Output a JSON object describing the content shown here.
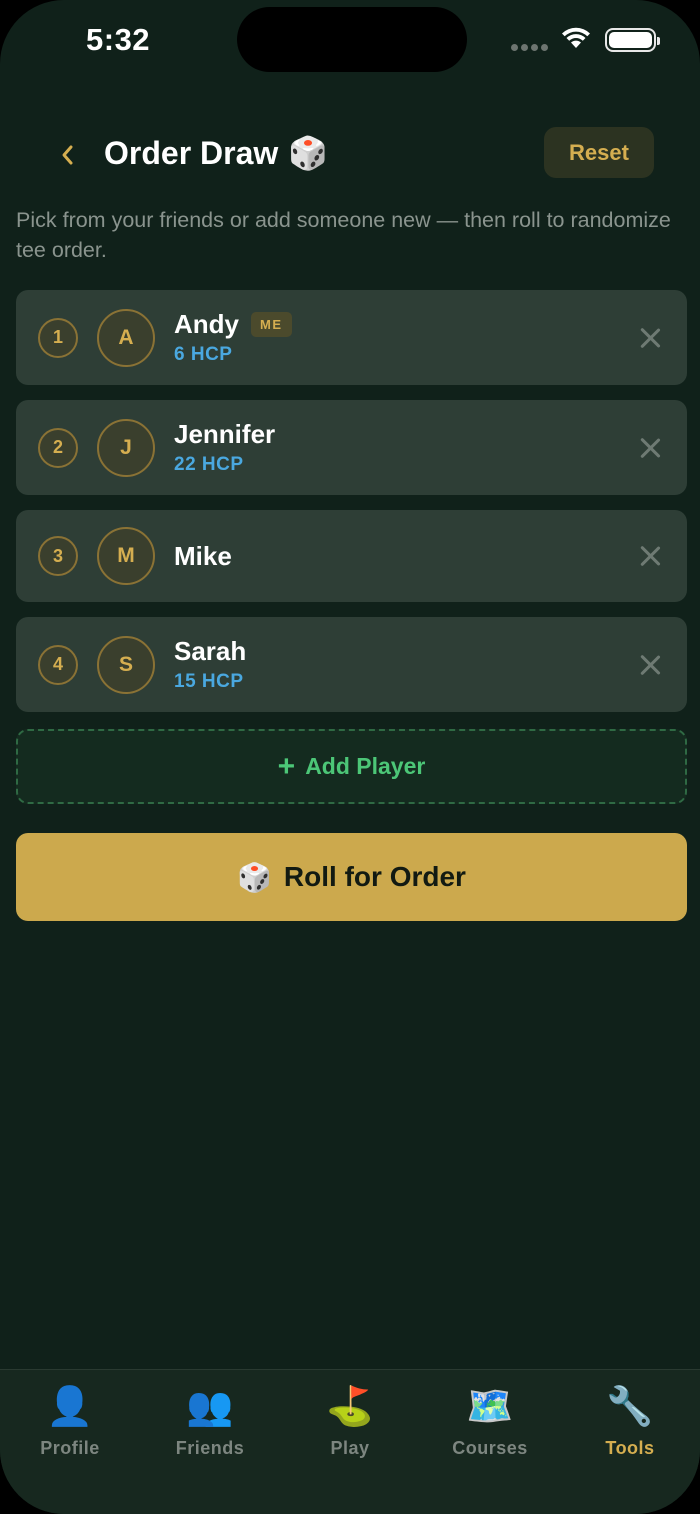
{
  "status_bar": {
    "time": "5:32"
  },
  "header": {
    "title": "Order Draw",
    "title_icon": "🎲",
    "reset_label": "Reset",
    "subtitle": "Pick from your friends or add someone new — then roll to randomize tee order."
  },
  "players": [
    {
      "rank": "1",
      "initial": "A",
      "name": "Andy",
      "badge": "ME",
      "hcp": "6 HCP"
    },
    {
      "rank": "2",
      "initial": "J",
      "name": "Jennifer",
      "hcp": "22 HCP"
    },
    {
      "rank": "3",
      "initial": "M",
      "name": "Mike"
    },
    {
      "rank": "4",
      "initial": "S",
      "name": "Sarah",
      "hcp": "15 HCP"
    }
  ],
  "add_player": {
    "icon": "+",
    "label": "Add Player"
  },
  "roll_button": {
    "icon": "🎲",
    "label": "Roll for Order"
  },
  "tabs": [
    {
      "icon": "👤",
      "label": "Profile"
    },
    {
      "icon": "👥",
      "label": "Friends"
    },
    {
      "icon": "⛳",
      "label": "Play"
    },
    {
      "icon": "🗺️",
      "label": "Courses"
    },
    {
      "icon": "🔧",
      "label": "Tools",
      "active": true
    }
  ],
  "colors": {
    "background": "#10211a",
    "accent_gold": "#d5ae50",
    "roll_button": "#cca94d",
    "add_green": "#4cc677",
    "hcp_blue": "#4aa8e0"
  }
}
